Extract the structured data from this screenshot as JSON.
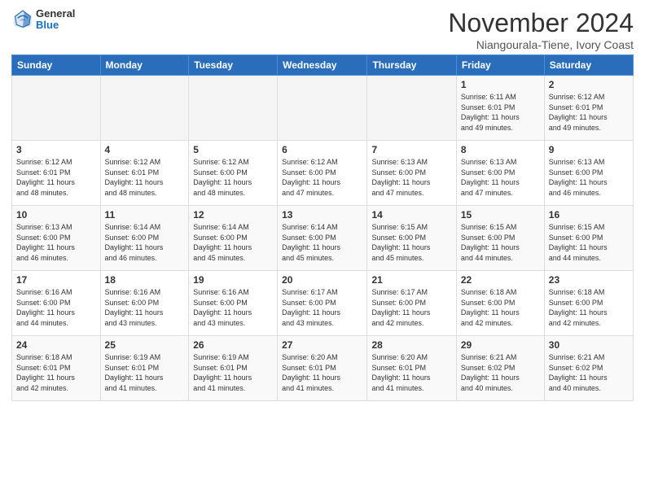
{
  "header": {
    "logo_general": "General",
    "logo_blue": "Blue",
    "month_title": "November 2024",
    "subtitle": "Niangourala-Tiene, Ivory Coast"
  },
  "weekdays": [
    "Sunday",
    "Monday",
    "Tuesday",
    "Wednesday",
    "Thursday",
    "Friday",
    "Saturday"
  ],
  "weeks": [
    [
      {
        "day": "",
        "info": ""
      },
      {
        "day": "",
        "info": ""
      },
      {
        "day": "",
        "info": ""
      },
      {
        "day": "",
        "info": ""
      },
      {
        "day": "",
        "info": ""
      },
      {
        "day": "1",
        "info": "Sunrise: 6:11 AM\nSunset: 6:01 PM\nDaylight: 11 hours\nand 49 minutes."
      },
      {
        "day": "2",
        "info": "Sunrise: 6:12 AM\nSunset: 6:01 PM\nDaylight: 11 hours\nand 49 minutes."
      }
    ],
    [
      {
        "day": "3",
        "info": "Sunrise: 6:12 AM\nSunset: 6:01 PM\nDaylight: 11 hours\nand 48 minutes."
      },
      {
        "day": "4",
        "info": "Sunrise: 6:12 AM\nSunset: 6:01 PM\nDaylight: 11 hours\nand 48 minutes."
      },
      {
        "day": "5",
        "info": "Sunrise: 6:12 AM\nSunset: 6:00 PM\nDaylight: 11 hours\nand 48 minutes."
      },
      {
        "day": "6",
        "info": "Sunrise: 6:12 AM\nSunset: 6:00 PM\nDaylight: 11 hours\nand 47 minutes."
      },
      {
        "day": "7",
        "info": "Sunrise: 6:13 AM\nSunset: 6:00 PM\nDaylight: 11 hours\nand 47 minutes."
      },
      {
        "day": "8",
        "info": "Sunrise: 6:13 AM\nSunset: 6:00 PM\nDaylight: 11 hours\nand 47 minutes."
      },
      {
        "day": "9",
        "info": "Sunrise: 6:13 AM\nSunset: 6:00 PM\nDaylight: 11 hours\nand 46 minutes."
      }
    ],
    [
      {
        "day": "10",
        "info": "Sunrise: 6:13 AM\nSunset: 6:00 PM\nDaylight: 11 hours\nand 46 minutes."
      },
      {
        "day": "11",
        "info": "Sunrise: 6:14 AM\nSunset: 6:00 PM\nDaylight: 11 hours\nand 46 minutes."
      },
      {
        "day": "12",
        "info": "Sunrise: 6:14 AM\nSunset: 6:00 PM\nDaylight: 11 hours\nand 45 minutes."
      },
      {
        "day": "13",
        "info": "Sunrise: 6:14 AM\nSunset: 6:00 PM\nDaylight: 11 hours\nand 45 minutes."
      },
      {
        "day": "14",
        "info": "Sunrise: 6:15 AM\nSunset: 6:00 PM\nDaylight: 11 hours\nand 45 minutes."
      },
      {
        "day": "15",
        "info": "Sunrise: 6:15 AM\nSunset: 6:00 PM\nDaylight: 11 hours\nand 44 minutes."
      },
      {
        "day": "16",
        "info": "Sunrise: 6:15 AM\nSunset: 6:00 PM\nDaylight: 11 hours\nand 44 minutes."
      }
    ],
    [
      {
        "day": "17",
        "info": "Sunrise: 6:16 AM\nSunset: 6:00 PM\nDaylight: 11 hours\nand 44 minutes."
      },
      {
        "day": "18",
        "info": "Sunrise: 6:16 AM\nSunset: 6:00 PM\nDaylight: 11 hours\nand 43 minutes."
      },
      {
        "day": "19",
        "info": "Sunrise: 6:16 AM\nSunset: 6:00 PM\nDaylight: 11 hours\nand 43 minutes."
      },
      {
        "day": "20",
        "info": "Sunrise: 6:17 AM\nSunset: 6:00 PM\nDaylight: 11 hours\nand 43 minutes."
      },
      {
        "day": "21",
        "info": "Sunrise: 6:17 AM\nSunset: 6:00 PM\nDaylight: 11 hours\nand 42 minutes."
      },
      {
        "day": "22",
        "info": "Sunrise: 6:18 AM\nSunset: 6:00 PM\nDaylight: 11 hours\nand 42 minutes."
      },
      {
        "day": "23",
        "info": "Sunrise: 6:18 AM\nSunset: 6:00 PM\nDaylight: 11 hours\nand 42 minutes."
      }
    ],
    [
      {
        "day": "24",
        "info": "Sunrise: 6:18 AM\nSunset: 6:01 PM\nDaylight: 11 hours\nand 42 minutes."
      },
      {
        "day": "25",
        "info": "Sunrise: 6:19 AM\nSunset: 6:01 PM\nDaylight: 11 hours\nand 41 minutes."
      },
      {
        "day": "26",
        "info": "Sunrise: 6:19 AM\nSunset: 6:01 PM\nDaylight: 11 hours\nand 41 minutes."
      },
      {
        "day": "27",
        "info": "Sunrise: 6:20 AM\nSunset: 6:01 PM\nDaylight: 11 hours\nand 41 minutes."
      },
      {
        "day": "28",
        "info": "Sunrise: 6:20 AM\nSunset: 6:01 PM\nDaylight: 11 hours\nand 41 minutes."
      },
      {
        "day": "29",
        "info": "Sunrise: 6:21 AM\nSunset: 6:02 PM\nDaylight: 11 hours\nand 40 minutes."
      },
      {
        "day": "30",
        "info": "Sunrise: 6:21 AM\nSunset: 6:02 PM\nDaylight: 11 hours\nand 40 minutes."
      }
    ]
  ]
}
